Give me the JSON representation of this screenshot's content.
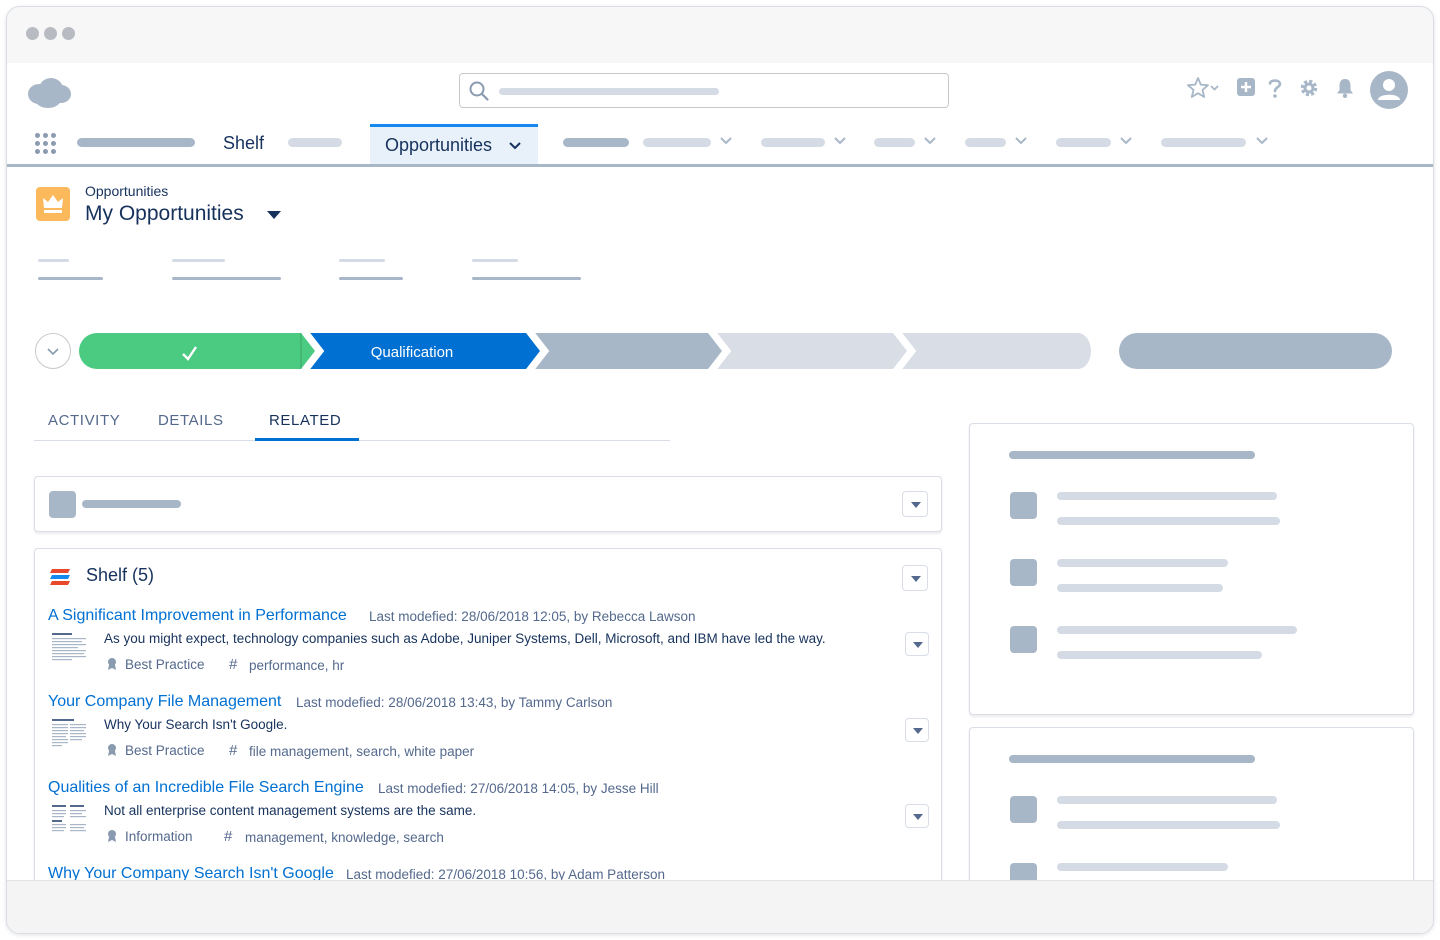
{
  "nav": {
    "shelf_label": "Shelf",
    "active_tab_label": "Opportunities"
  },
  "record": {
    "object_label": "Opportunities",
    "title": "My Opportunities"
  },
  "path": {
    "current_stage": "Qualification"
  },
  "tabs": [
    "ACTIVITY",
    "DETAILS",
    "RELATED"
  ],
  "shelf": {
    "title": "Shelf (5)",
    "items": [
      {
        "title": "A Significant Improvement in Performance",
        "meta": "Last modefied: 28/06/2018 12:05, by Rebecca Lawson",
        "description": "As you might expect, technology companies such as Adobe, Juniper Systems, Dell, Microsoft, and IBM have led the way.",
        "type": "Best Practice",
        "tags": "performance, hr"
      },
      {
        "title": "Your Company File Management",
        "meta": "Last modefied: 28/06/2018 13:43, by Tammy Carlson",
        "description": "Why Your Search Isn't Google.",
        "type": "Best Practice",
        "tags": "file management, search, white paper"
      },
      {
        "title": "Qualities of an Incredible File Search Engine",
        "meta": "Last modefied: 27/06/2018 14:05, by Jesse Hill",
        "description": "Not all enterprise content management systems are the same.",
        "type": "Information",
        "tags": "management, knowledge, search"
      },
      {
        "title": "Why Your Company Search Isn't Google",
        "meta": "Last modefied: 27/06/2018 10:56, by Adam Patterson"
      }
    ]
  },
  "colors": {
    "brand_blue": "#0070d2",
    "complete_green": "#4bca81",
    "current_blue": "#0070d2",
    "placeholder": "#a8b7c7",
    "placeholder_light": "#d4dbe5",
    "opportunity_orange": "#fcb95b"
  }
}
